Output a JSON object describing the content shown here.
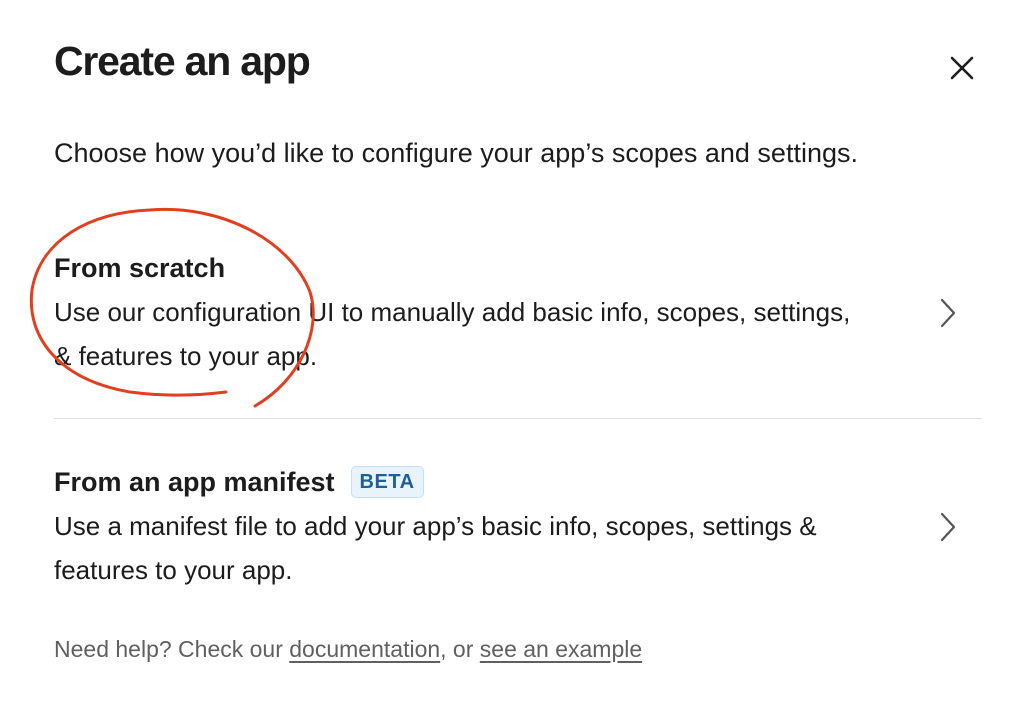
{
  "modal": {
    "title": "Create an app",
    "subtitle": "Choose how you’d like to configure your app’s scopes and settings."
  },
  "options": [
    {
      "title": "From scratch",
      "description": "Use our configuration UI to manually add basic info, scopes, settings, & features to your app."
    },
    {
      "title": "From an app manifest",
      "badge": "BETA",
      "description": "Use a manifest file to add your app’s basic info, scopes, settings & features to your app."
    }
  ],
  "help": {
    "prefix": "Need help? Check our ",
    "documentation_link": "documentation",
    "middle": ", or ",
    "example_link": "see an example"
  },
  "colors": {
    "text": "#1d1c1d",
    "muted": "#616061",
    "badge_bg": "#e8f3fb",
    "badge_text": "#1d5f98",
    "annotation": "#e0401f"
  },
  "icons": {
    "close": "close-icon",
    "chevron": "chevron-right-icon"
  }
}
